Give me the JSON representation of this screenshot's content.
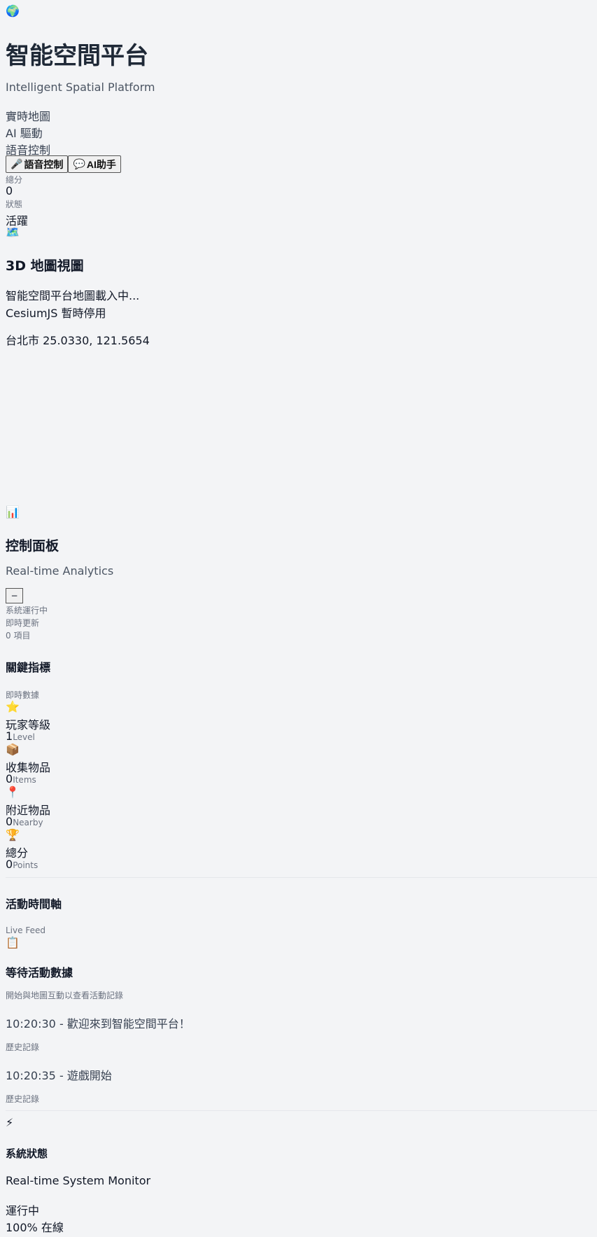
{
  "hero": {
    "icon": "🌍",
    "title": "智能空間平台",
    "subtitle": "Intelligent Spatial Platform",
    "features": [
      "實時地圖",
      "AI 驅動",
      "語音控制"
    ],
    "buttons": [
      {
        "icon": "🎤",
        "label": "語音控制"
      },
      {
        "icon": "💬",
        "label": "AI助手"
      }
    ],
    "stats": {
      "score_label": "總分",
      "score_value": "0",
      "status_label": "狀態",
      "status_value": "活躍"
    }
  },
  "map": {
    "icon": "🗺️",
    "title": "3D 地圖視圖",
    "loading_text": "智能空間平台地圖載入中...",
    "cesium_text": "CesiumJS 暫時停用",
    "location_text": "台北市 25.0330, 121.5654"
  },
  "panel": {
    "icon": "📊",
    "title": "控制面板",
    "subtitle": "Real-time Analytics",
    "collapse_label": "−",
    "status_running": "系統運行中",
    "status_update": "即時更新",
    "item_count": "0 項目"
  },
  "metrics": {
    "title": "關鍵指標",
    "subtitle": "即時數據",
    "items": [
      {
        "icon": "⭐",
        "label": "玩家等級",
        "value": "1",
        "unit": "Level"
      },
      {
        "icon": "📦",
        "label": "收集物品",
        "value": "0",
        "unit": "Items"
      },
      {
        "icon": "📍",
        "label": "附近物品",
        "value": "0",
        "unit": "Nearby"
      },
      {
        "icon": "🏆",
        "label": "總分",
        "value": "0",
        "unit": "Points"
      }
    ]
  },
  "timeline": {
    "title": "活動時間軸",
    "subtitle": "Live Feed",
    "empty_icon": "📋",
    "empty_title": "等待活動數據",
    "empty_text": "開始與地圖互動以查看活動記錄",
    "entries": [
      {
        "text": "10:20:30 - 歡迎來到智能空間平台！",
        "tag": "歷史記錄"
      },
      {
        "text": "10:20:35 - 遊戲開始",
        "tag": "歷史記錄"
      }
    ]
  },
  "system": {
    "icon": "⚡",
    "title": "系統狀態",
    "subtitle": "Real-time System Monitor",
    "state": "運行中",
    "uptime": "100% 在線"
  }
}
